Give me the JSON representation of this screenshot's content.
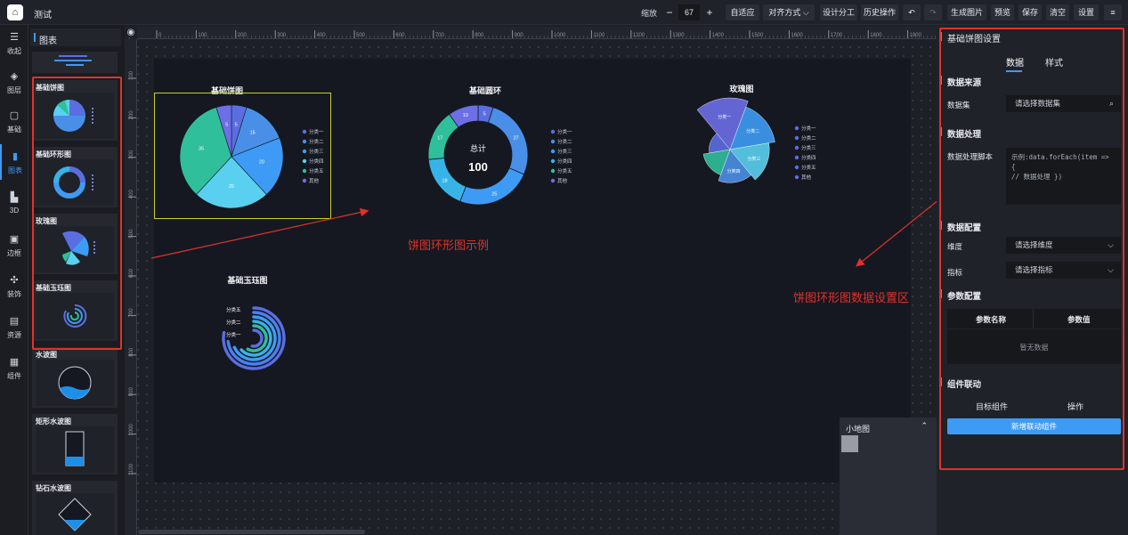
{
  "app": {
    "logo_glyph": "⌂",
    "title": "测试"
  },
  "toolbar": {
    "zoom_label": "缩放",
    "zoom_minus": "−",
    "zoom_value": "67",
    "zoom_plus": "+",
    "buttons": [
      "自适应",
      "对齐方式 ⌵",
      "设计分工",
      "历史操作",
      "↶",
      "↷",
      "生成图片",
      "预览",
      "保存",
      "清空",
      "设置",
      "≡"
    ]
  },
  "nav": [
    {
      "icon": "collapse-icon",
      "glyph": "☰",
      "label": "收起"
    },
    {
      "icon": "layers-icon",
      "glyph": "◈",
      "label": "图层"
    },
    {
      "icon": "basic-icon",
      "glyph": "▢",
      "label": "基础"
    },
    {
      "icon": "chart-icon",
      "glyph": "▮",
      "label": "图表"
    },
    {
      "icon": "3d-icon",
      "glyph": "▙",
      "label": "3D"
    },
    {
      "icon": "border-icon",
      "glyph": "▣",
      "label": "边框"
    },
    {
      "icon": "decoration-icon",
      "glyph": "✣",
      "label": "装饰"
    },
    {
      "icon": "resource-icon",
      "glyph": "▤",
      "label": "资源"
    },
    {
      "icon": "component-icon",
      "glyph": "▦",
      "label": "组件"
    }
  ],
  "component_panel": {
    "title": "图表",
    "cards": [
      "基础饼图",
      "基础环形图",
      "玫瑰图",
      "基础玉珏图",
      "水波图",
      "矩形水波图",
      "钻石水波图"
    ]
  },
  "canvas": {
    "ruler_ticks": [
      "0",
      "100",
      "200",
      "300",
      "400",
      "500",
      "600",
      "700",
      "800",
      "900",
      "1000",
      "1100",
      "1200",
      "1300",
      "1400",
      "1500",
      "1600",
      "1700",
      "1800",
      "1900"
    ],
    "ruler_left_ticks": [
      "100",
      "200",
      "300",
      "400",
      "500",
      "600",
      "700",
      "800",
      "900",
      "1000",
      "1100"
    ],
    "annotation_left": "饼图环形图示例",
    "annotation_right": "饼图环形图数据设置区"
  },
  "chart_data": [
    {
      "type": "pie",
      "title": "基础饼图",
      "categories": [
        "分类一",
        "分类二",
        "分类三",
        "分类四",
        "分类五",
        "其他"
      ],
      "values": [
        5,
        15,
        20,
        25,
        35,
        5
      ],
      "colors": [
        "#5b6ee1",
        "#4a8fe7",
        "#3e9bf5",
        "#5ad0f0",
        "#2fbf9b",
        "#6c6fe6"
      ]
    },
    {
      "type": "pie",
      "title": "基础圆环",
      "center_label": "总计",
      "center_value": "100",
      "categories": [
        "分类一",
        "分类二",
        "分类三",
        "分类四",
        "分类五",
        "其他"
      ],
      "values": [
        5,
        27,
        25,
        18,
        17,
        10
      ],
      "colors": [
        "#5b6ee1",
        "#4a8fe7",
        "#3e9bf5",
        "#37b3e6",
        "#2fbf9b",
        "#6c6fe6"
      ]
    },
    {
      "type": "pie",
      "title": "玫瑰图",
      "categories": [
        "分类一",
        "分类二",
        "分类三",
        "分类四",
        "分类五",
        "其他"
      ],
      "slice_labels": [
        "分类一",
        "分类二",
        "分类三",
        "分类四"
      ],
      "values": [
        100,
        85,
        70,
        55,
        40,
        25
      ]
    },
    {
      "type": "bar",
      "title": "基础玉珏图",
      "categories": [
        "分类五",
        "分类二",
        "分类一"
      ]
    }
  ],
  "minimap": {
    "title": "小地图",
    "chevron": "⌃"
  },
  "settings": {
    "title": "基础饼图设置",
    "tabs": [
      "数据",
      "样式"
    ],
    "sections": {
      "source": "数据来源",
      "dataset_label": "数据集",
      "dataset_placeholder": "请选择数据集",
      "process": "数据处理",
      "script_label": "数据处理脚本",
      "script_line1": "示例:data.forEach(item => {",
      "script_line2": "// 数据处理 })",
      "config": "数据配置",
      "dimension_label": "维度",
      "dimension_placeholder": "请选择维度",
      "metric_label": "指标",
      "metric_placeholder": "请选择指标",
      "params": "参数配置",
      "param_name": "参数名称",
      "param_value": "参数值",
      "empty": "暂无数据",
      "linkage": "组件联动",
      "target": "目标组件",
      "action": "操作",
      "add_button": "新增联动组件"
    },
    "icons": {
      "search": "⌕",
      "chevron": "⌵"
    }
  }
}
